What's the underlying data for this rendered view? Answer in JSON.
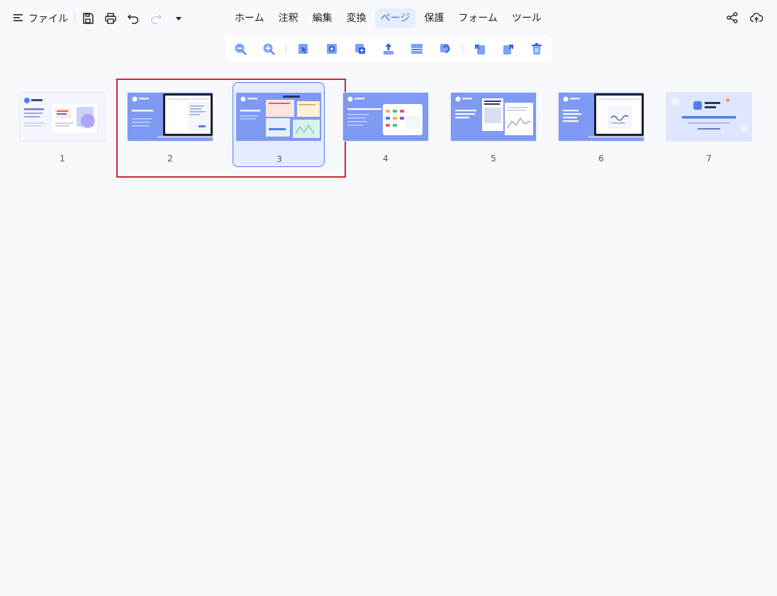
{
  "menu": {
    "label": "ファイル"
  },
  "tabs": [
    {
      "label": "ホーム"
    },
    {
      "label": "注釈"
    },
    {
      "label": "編集"
    },
    {
      "label": "変換"
    },
    {
      "label": "ページ"
    },
    {
      "label": "保護"
    },
    {
      "label": "フォーム"
    },
    {
      "label": "ツール"
    }
  ],
  "active_tab": "ページ",
  "pages": [
    {
      "number": "1"
    },
    {
      "number": "2"
    },
    {
      "number": "3"
    },
    {
      "number": "4"
    },
    {
      "number": "5"
    },
    {
      "number": "6"
    },
    {
      "number": "7"
    }
  ],
  "selected_page": "3",
  "colors": {
    "accent": "#3b6fe8",
    "selection_outline": "#d6232f",
    "thumb_blue": "#7e9af2"
  }
}
